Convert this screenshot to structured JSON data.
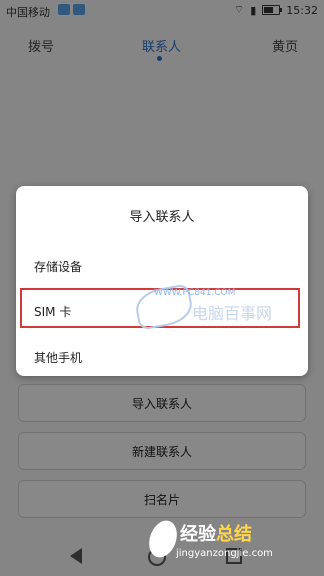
{
  "status_bar": {
    "carrier": "中国移动",
    "time": "15:32"
  },
  "tabs": [
    {
      "label": "拨号"
    },
    {
      "label": "联系人",
      "active": true
    },
    {
      "label": "黄页"
    }
  ],
  "dialog": {
    "title": "导入联系人",
    "options": [
      {
        "label": "存储设备"
      },
      {
        "label": "SIM 卡",
        "highlighted": true
      },
      {
        "label": "其他手机"
      }
    ]
  },
  "watermark": {
    "url_text": "WWW.PC841.COM",
    "brand_text": "电脑百事网",
    "bottom_title_1": "经验",
    "bottom_title_2": "总结",
    "bottom_url": "jingyanzongjie.com"
  },
  "buttons": [
    {
      "label": "导入联系人"
    },
    {
      "label": "新建联系人"
    },
    {
      "label": "扫名片"
    }
  ],
  "colors": {
    "accent_blue": "#2a6fc9",
    "highlight_red": "#d23a3a"
  }
}
